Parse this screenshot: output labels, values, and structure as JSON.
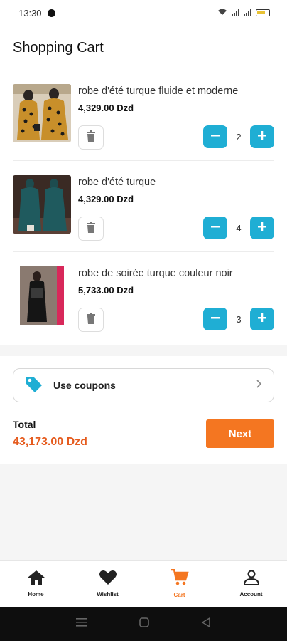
{
  "status_bar": {
    "time": "13:30",
    "icons": [
      "messenger-icon",
      "wifi-icon",
      "signal-icon",
      "signal-icon",
      "battery-icon"
    ]
  },
  "header": {
    "title": "Shopping Cart"
  },
  "cart": {
    "items": [
      {
        "name": "robe d'été turque fluide et moderne",
        "price": "4,329.00 Dzd",
        "quantity": "2",
        "image": "mustard-polka-dress-photo"
      },
      {
        "name": "robe d'été turque",
        "price": "4,329.00 Dzd",
        "quantity": "4",
        "image": "teal-dress-photo"
      },
      {
        "name": "robe de soirée turque couleur noir",
        "price": "5,733.00 Dzd",
        "quantity": "3",
        "image": "black-evening-dress-photo"
      }
    ]
  },
  "coupon": {
    "label": "Use coupons",
    "icon": "tag-icon"
  },
  "summary": {
    "total_label": "Total",
    "total_value": "43,173.00 Dzd",
    "next_label": "Next"
  },
  "bottom_nav": {
    "items": [
      {
        "label": "Home",
        "icon": "home-icon"
      },
      {
        "label": "Wishlist",
        "icon": "heart-icon"
      },
      {
        "label": "Cart",
        "icon": "cart-icon",
        "active": true
      },
      {
        "label": "Account",
        "icon": "account-icon"
      }
    ]
  },
  "colors": {
    "accent": "#1faed4",
    "brand_orange": "#f47621",
    "total_red": "#e55b1e"
  }
}
